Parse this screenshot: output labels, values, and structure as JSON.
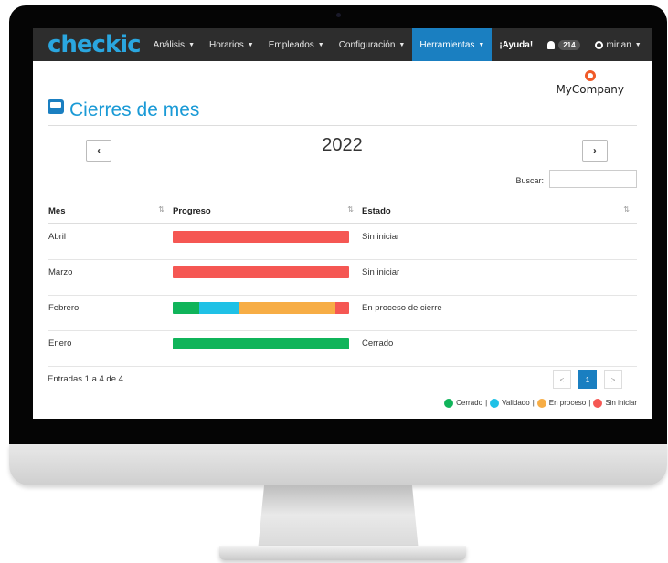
{
  "navbar": {
    "logo": "checkic",
    "items": [
      {
        "label": "Análisis",
        "caret": true
      },
      {
        "label": "Horarios",
        "caret": true
      },
      {
        "label": "Empleados",
        "caret": true
      },
      {
        "label": "Configuración",
        "caret": true
      },
      {
        "label": "Herramientas",
        "caret": true,
        "active": true
      },
      {
        "label": "¡Ayuda!",
        "caret": false
      }
    ],
    "notifications_count": "214",
    "user": "mirian"
  },
  "page": {
    "title": "Cierres de mes",
    "company": "MyCompany",
    "year": "2022",
    "prev_label": "‹",
    "next_label": "›",
    "search_label": "Buscar:",
    "search_value": ""
  },
  "table": {
    "columns": [
      "Mes",
      "Progreso",
      "Estado"
    ],
    "rows": [
      {
        "mes": "Abril",
        "estado": "Sin iniciar",
        "progress": [
          {
            "status": "sin_iniciar",
            "fraction": 1.0
          }
        ]
      },
      {
        "mes": "Marzo",
        "estado": "Sin iniciar",
        "progress": [
          {
            "status": "sin_iniciar",
            "fraction": 1.0
          }
        ]
      },
      {
        "mes": "Febrero",
        "estado": "En proceso de cierre",
        "progress": [
          {
            "status": "cerrado",
            "fraction": 0.15
          },
          {
            "status": "validado",
            "fraction": 0.23
          },
          {
            "status": "en_proceso",
            "fraction": 0.54
          },
          {
            "status": "sin_iniciar",
            "fraction": 0.08
          }
        ]
      },
      {
        "mes": "Enero",
        "estado": "Cerrado",
        "progress": [
          {
            "status": "cerrado",
            "fraction": 1.0
          }
        ]
      }
    ]
  },
  "footer": {
    "entries_text": "Entradas 1 a 4 de 4",
    "pager": {
      "prev": "<",
      "current": "1",
      "next": ">"
    }
  },
  "legend": [
    {
      "label": "Cerrado",
      "color": "#10b45a"
    },
    {
      "label": "Validado",
      "color": "#1fc1e6"
    },
    {
      "label": "En proceso",
      "color": "#f7ad45"
    },
    {
      "label": "Sin iniciar",
      "color": "#f55753"
    }
  ],
  "colors": {
    "accent": "#1a7fc1",
    "title": "#1a9ad6",
    "navbar": "#2d2d2d",
    "cerrado": "#10b45a",
    "validado": "#1fc1e6",
    "en_proceso": "#f7ad45",
    "sin_iniciar": "#f55753"
  }
}
